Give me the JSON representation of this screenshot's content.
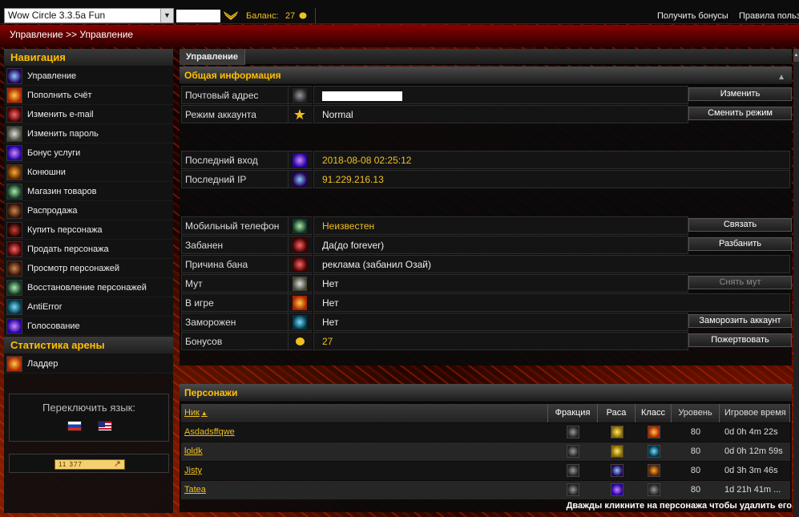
{
  "topbar": {
    "server": "Wow Circle 3.3.5a Fun",
    "balance_label": "Баланс:",
    "balance_value": "27",
    "link_bonus": "Получить бонусы",
    "link_rules": "Правила польз"
  },
  "breadcrumb": "Управление >> Управление",
  "sidebar": {
    "nav_title": "Навигация",
    "items": [
      {
        "label": "Управление",
        "icon": "management-icon",
        "color": "blue"
      },
      {
        "label": "Пополнить счёт",
        "icon": "top-up-icon",
        "color": "fire"
      },
      {
        "label": "Изменить e-mail",
        "icon": "email-icon",
        "color": "red"
      },
      {
        "label": "Изменить пароль",
        "icon": "password-icon",
        "color": "pale"
      },
      {
        "label": "Бонус услуги",
        "icon": "bonus-services-icon",
        "color": "purple"
      },
      {
        "label": "Конюшни",
        "icon": "stables-icon",
        "color": "orange"
      },
      {
        "label": "Магазин товаров",
        "icon": "shop-icon",
        "color": "green"
      },
      {
        "label": "Распродажа",
        "icon": "sale-icon",
        "color": "brown"
      },
      {
        "label": "Купить персонажа",
        "icon": "buy-character-icon",
        "color": "dkred"
      },
      {
        "label": "Продать персонажа",
        "icon": "sell-character-icon",
        "color": "red"
      },
      {
        "label": "Просмотр персонажей",
        "icon": "view-characters-icon",
        "color": "brown"
      },
      {
        "label": "Восстановление персонажей",
        "icon": "restore-characters-icon",
        "color": "green"
      },
      {
        "label": "AntiError",
        "icon": "antierror-icon",
        "color": "teal"
      },
      {
        "label": "Голосование",
        "icon": "voting-icon",
        "color": "purple"
      }
    ],
    "arena_title": "Статистика арены",
    "arena_items": [
      {
        "label": "Ладдер",
        "icon": "ladder-icon",
        "color": "fire"
      }
    ],
    "lang_label": "Переключить язык:",
    "counter_text": "11 377"
  },
  "main": {
    "tab": "Управление",
    "info_title": "Общая информация",
    "rows": {
      "email": {
        "label": "Почтовый адрес",
        "button": "Изменить"
      },
      "mode": {
        "label": "Режим аккаунта",
        "value": "Normal",
        "button": "Сменить режим"
      },
      "last_login": {
        "label": "Последний вход",
        "value": "2018-08-08 02:25:12"
      },
      "last_ip": {
        "label": "Последний IP",
        "value": "91.229.216.13"
      },
      "phone": {
        "label": "Мобильный телефон",
        "value": "Неизвестен",
        "button": "Связать"
      },
      "banned": {
        "label": "Забанен",
        "value": "Да(до forever)",
        "button": "Разбанить"
      },
      "ban_reason": {
        "label": "Причина бана",
        "value": "реклама (забанил Озай)"
      },
      "mute": {
        "label": "Мут",
        "value": "Нет",
        "button": "Снять мут"
      },
      "in_game": {
        "label": "В игре",
        "value": "Нет"
      },
      "frozen": {
        "label": "Заморожен",
        "value": "Нет",
        "button": "Заморозить аккаунт"
      },
      "bonuses": {
        "label": "Бонусов",
        "value": "27",
        "button": "Пожертвовать"
      }
    },
    "chars_title": "Персонажи",
    "chars_headers": {
      "nick": "Ник",
      "faction": "Фракция",
      "race": "Раса",
      "class": "Класс",
      "level": "Уровень",
      "playtime": "Игровое время"
    },
    "characters": [
      {
        "nick": "Asdadsffqwe",
        "level": "80",
        "playtime": "0d 0h 4m 22s"
      },
      {
        "nick": "loldk",
        "level": "80",
        "playtime": "0d 0h 12m 59s"
      },
      {
        "nick": "Jisty",
        "level": "80",
        "playtime": "0d 3h 3m 46s"
      },
      {
        "nick": "Tatea",
        "level": "80",
        "playtime": "1d 21h 41m ..."
      }
    ],
    "chars_hint": "Дважды кликните на персонажа чтобы удалить его"
  },
  "colors": {
    "accent_gold": "#ffc000",
    "link_gold": "#f0c020",
    "header_red": "#8a0000"
  }
}
